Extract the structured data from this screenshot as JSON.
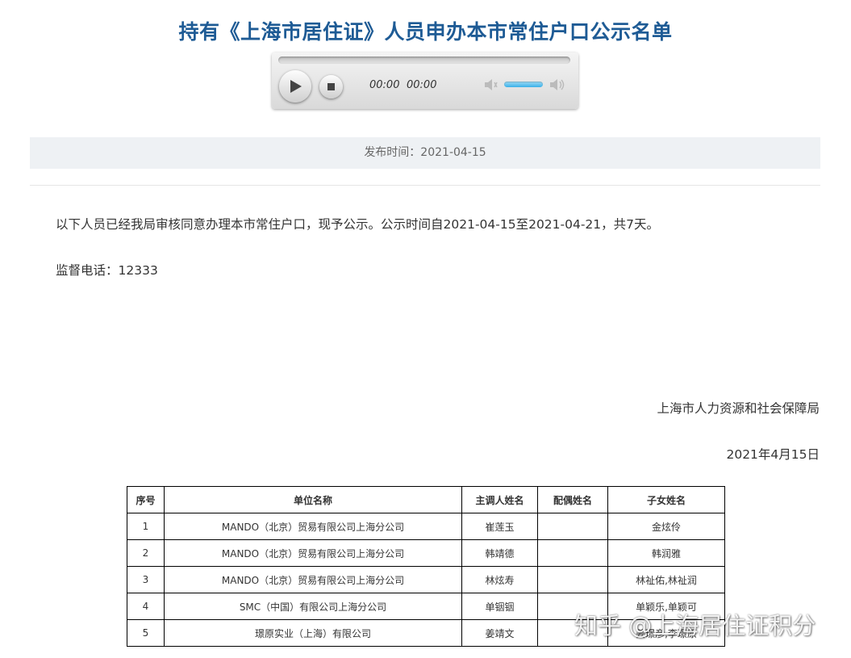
{
  "article": {
    "title": "持有《上海市居住证》人员申办本市常住户口公示名单",
    "publish_label": "发布时间：2021-04-15",
    "intro": "以下人员已经我局审核同意办理本市常住户口，现予公示。公示时间自2021-04-15至2021-04-21，共7天。",
    "hotline": "监督电话：12333",
    "issuer": "上海市人力资源和社会保障局",
    "date": "2021年4月15日"
  },
  "player": {
    "current_time": "00:00",
    "duration": "00:00",
    "progress": 0,
    "volume": 0.8
  },
  "table": {
    "headers": [
      "序号",
      "单位名称",
      "主调人姓名",
      "配偶姓名",
      "子女姓名"
    ],
    "rows": [
      [
        "1",
        "MANDO（北京）贸易有限公司上海分公司",
        "崔莲玉",
        "",
        "金炫伶"
      ],
      [
        "2",
        "MANDO（北京）贸易有限公司上海分公司",
        "韩靖德",
        "",
        "韩润雅"
      ],
      [
        "3",
        "MANDO（北京）贸易有限公司上海分公司",
        "林炫寿",
        "",
        "林祉佑,林祉润"
      ],
      [
        "4",
        "SMC（中国）有限公司上海分公司",
        "单铟铟",
        "",
        "单颖乐,单颖可"
      ],
      [
        "5",
        "璟原实业（上海）有限公司",
        "姜靖文",
        "",
        "姜璟彦,李璟原"
      ]
    ]
  },
  "watermark": "知乎 @上海居住证积分"
}
